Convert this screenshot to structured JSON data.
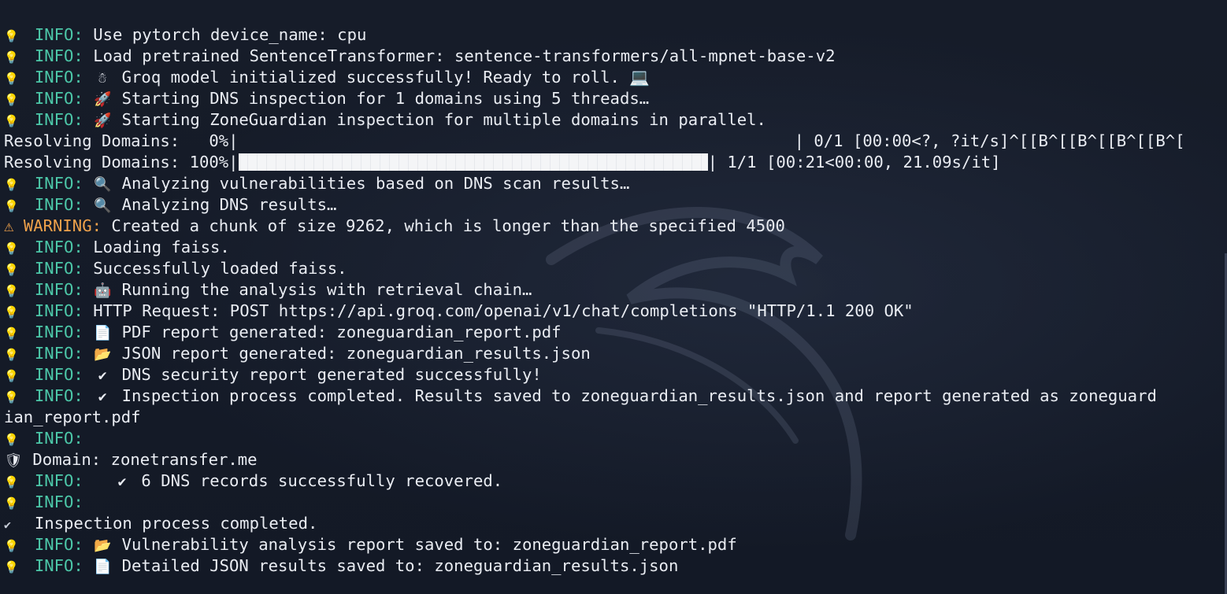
{
  "log_lines": [
    {
      "icon": "💡",
      "level": "INFO:",
      "emoji": "",
      "text": "Use pytorch device_name: cpu"
    },
    {
      "icon": "💡",
      "level": "INFO:",
      "emoji": "",
      "text": "Load pretrained SentenceTransformer: sentence-transformers/all-mpnet-base-v2"
    },
    {
      "icon": "💡",
      "level": "INFO:",
      "emoji": "☃",
      "text": "Groq model initialized successfully! Ready to roll. 💻"
    },
    {
      "icon": "💡",
      "level": "INFO:",
      "emoji": "🚀",
      "text": "Starting DNS inspection for 1 domains using 5 threads…"
    },
    {
      "icon": "💡",
      "level": "INFO:",
      "emoji": "🚀",
      "text": "Starting ZoneGuardian inspection for multiple domains in parallel."
    }
  ],
  "progress": [
    {
      "label": "Resolving Domains:   0%|",
      "fraction": 0,
      "stats": "| 0/1 [00:00<?, ?it/s]^[[B^[[B^[[B^[[B^["
    },
    {
      "label": "Resolving Domains: 100%|",
      "fraction": 1,
      "stats": "| 1/1 [00:21<00:00, 21.09s/it]"
    }
  ],
  "log_lines_2": [
    {
      "icon": "💡",
      "level": "INFO:",
      "emoji": "🔍",
      "text": "Analyzing vulnerabilities based on DNS scan results…"
    },
    {
      "icon": "💡",
      "level": "INFO:",
      "emoji": "🔍",
      "text": "Analyzing DNS results…"
    }
  ],
  "warning": {
    "icon": "⚠",
    "level": "WARNING:",
    "text": "Created a chunk of size 9262, which is longer than the specified 4500"
  },
  "log_lines_3": [
    {
      "icon": "💡",
      "level": "INFO:",
      "emoji": "",
      "text": "Loading faiss."
    },
    {
      "icon": "💡",
      "level": "INFO:",
      "emoji": "",
      "text": "Successfully loaded faiss."
    },
    {
      "icon": "💡",
      "level": "INFO:",
      "emoji": "🤖",
      "text": "Running the analysis with retrieval chain…"
    },
    {
      "icon": "💡",
      "level": "INFO:",
      "emoji": "",
      "text": "HTTP Request: POST https://api.groq.com/openai/v1/chat/completions \"HTTP/1.1 200 OK\""
    },
    {
      "icon": "💡",
      "level": "INFO:",
      "emoji": "📄",
      "text": "PDF report generated: zoneguardian_report.pdf"
    },
    {
      "icon": "💡",
      "level": "INFO:",
      "emoji": "📂",
      "text": "JSON report generated: zoneguardian_results.json"
    },
    {
      "icon": "💡",
      "level": "INFO:",
      "emoji": "✔",
      "text": "DNS security report generated successfully!"
    },
    {
      "icon": "💡",
      "level": "INFO:",
      "emoji": "✔",
      "text": "Inspection process completed. Results saved to zoneguardian_results.json and report generated as zoneguard"
    }
  ],
  "wrap_line": "ian_report.pdf",
  "info_blank_1": {
    "icon": "💡",
    "level": "INFO:"
  },
  "domain_line": {
    "icon": "🛡",
    "text": "Domain: zonetransfer.me"
  },
  "records_line": {
    "icon": "💡",
    "level": "INFO:",
    "emoji": "✔",
    "text": "6 DNS records successfully recovered."
  },
  "info_blank_2": {
    "icon": "💡",
    "level": "INFO:"
  },
  "complete_line": {
    "icon": "✔",
    "text": "Inspection process completed."
  },
  "log_lines_4": [
    {
      "icon": "💡",
      "level": "INFO:",
      "emoji": "📂",
      "text": "Vulnerability analysis report saved to: zoneguardian_report.pdf"
    },
    {
      "icon": "💡",
      "level": "INFO:",
      "emoji": "📄",
      "text": "Detailed JSON results saved to: zoneguardian_results.json"
    }
  ],
  "colors": {
    "info": "#4cc7a8",
    "warning": "#f0a24b",
    "text": "#e9ecf2",
    "background": "#141a27"
  }
}
